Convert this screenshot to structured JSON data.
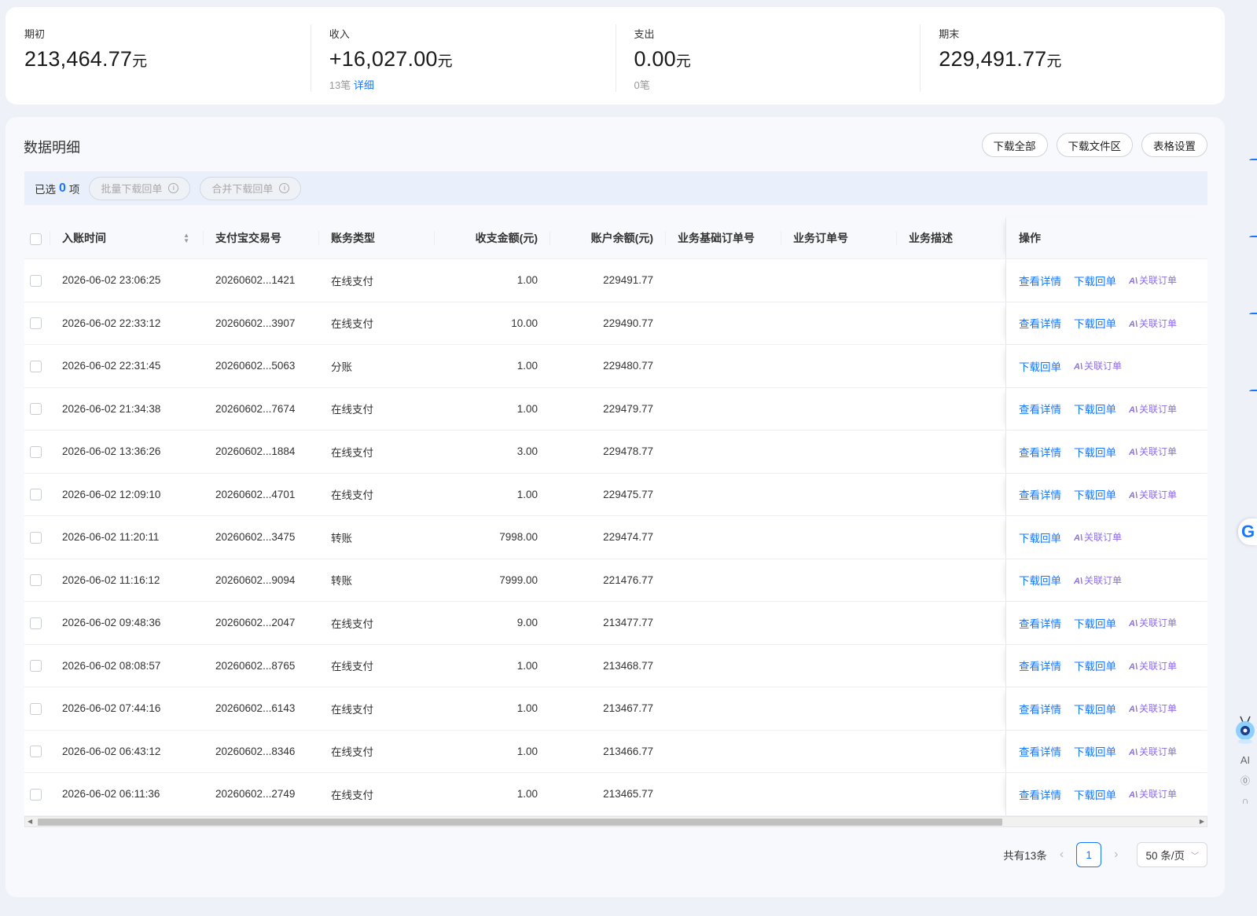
{
  "summary": {
    "items": [
      {
        "label": "期初",
        "value": "213,464.77",
        "unit": "元",
        "sub_count": "",
        "sub_link": ""
      },
      {
        "label": "收入",
        "value": "+16,027.00",
        "unit": "元",
        "sub_count": "13笔",
        "sub_link": "详细"
      },
      {
        "label": "支出",
        "value": "0.00",
        "unit": "元",
        "sub_count": "0笔",
        "sub_link": ""
      },
      {
        "label": "期末",
        "value": "229,491.77",
        "unit": "元",
        "sub_count": "",
        "sub_link": ""
      }
    ]
  },
  "panel": {
    "title": "数据明细",
    "buttons": [
      "下载全部",
      "下载文件区",
      "表格设置"
    ]
  },
  "selection": {
    "prefix": "已选",
    "count": "0",
    "suffix": "项",
    "batch_download": "批量下载回单",
    "merge_download": "合并下载回单"
  },
  "table": {
    "columns": [
      "入账时间",
      "支付宝交易号",
      "账务类型",
      "收支金额(元)",
      "账户余额(元)",
      "业务基础订单号",
      "业务订单号",
      "业务描述",
      "操作"
    ],
    "rows": [
      {
        "time": "2026-06-02 23:06:25",
        "tx": "20260602...1421",
        "type": "在线支付",
        "amount": "1.00",
        "balance": "229491.77",
        "ops": [
          "查看详情",
          "下载回单"
        ],
        "rel": "关联订单"
      },
      {
        "time": "2026-06-02 22:33:12",
        "tx": "20260602...3907",
        "type": "在线支付",
        "amount": "10.00",
        "balance": "229490.77",
        "ops": [
          "查看详情",
          "下载回单"
        ],
        "rel": "关联订单"
      },
      {
        "time": "2026-06-02 22:31:45",
        "tx": "20260602...5063",
        "type": "分账",
        "amount": "1.00",
        "balance": "229480.77",
        "ops": [
          "下载回单"
        ],
        "rel": "关联订单"
      },
      {
        "time": "2026-06-02 21:34:38",
        "tx": "20260602...7674",
        "type": "在线支付",
        "amount": "1.00",
        "balance": "229479.77",
        "ops": [
          "查看详情",
          "下载回单"
        ],
        "rel": "关联订单"
      },
      {
        "time": "2026-06-02 13:36:26",
        "tx": "20260602...1884",
        "type": "在线支付",
        "amount": "3.00",
        "balance": "229478.77",
        "ops": [
          "查看详情",
          "下载回单"
        ],
        "rel": "关联订单"
      },
      {
        "time": "2026-06-02 12:09:10",
        "tx": "20260602...4701",
        "type": "在线支付",
        "amount": "1.00",
        "balance": "229475.77",
        "ops": [
          "查看详情",
          "下载回单"
        ],
        "rel": "关联订单"
      },
      {
        "time": "2026-06-02 11:20:11",
        "tx": "20260602...3475",
        "type": "转账",
        "amount": "7998.00",
        "balance": "229474.77",
        "ops": [
          "下载回单"
        ],
        "rel": "关联订单"
      },
      {
        "time": "2026-06-02 11:16:12",
        "tx": "20260602...9094",
        "type": "转账",
        "amount": "7999.00",
        "balance": "221476.77",
        "ops": [
          "下载回单"
        ],
        "rel": "关联订单"
      },
      {
        "time": "2026-06-02 09:48:36",
        "tx": "20260602...2047",
        "type": "在线支付",
        "amount": "9.00",
        "balance": "213477.77",
        "ops": [
          "查看详情",
          "下载回单"
        ],
        "rel": "关联订单"
      },
      {
        "time": "2026-06-02 08:08:57",
        "tx": "20260602...8765",
        "type": "在线支付",
        "amount": "1.00",
        "balance": "213468.77",
        "ops": [
          "查看详情",
          "下载回单"
        ],
        "rel": "关联订单"
      },
      {
        "time": "2026-06-02 07:44:16",
        "tx": "20260602...6143",
        "type": "在线支付",
        "amount": "1.00",
        "balance": "213467.77",
        "ops": [
          "查看详情",
          "下载回单"
        ],
        "rel": "关联订单"
      },
      {
        "time": "2026-06-02 06:43:12",
        "tx": "20260602...8346",
        "type": "在线支付",
        "amount": "1.00",
        "balance": "213466.77",
        "ops": [
          "查看详情",
          "下载回单"
        ],
        "rel": "关联订单"
      },
      {
        "time": "2026-06-02 06:11:36",
        "tx": "20260602...2749",
        "type": "在线支付",
        "amount": "1.00",
        "balance": "213465.77",
        "ops": [
          "查看详情",
          "下载回单"
        ],
        "rel": "关联订单"
      }
    ]
  },
  "pagination": {
    "total": "共有13条",
    "current": "1",
    "page_size": "50 条/页"
  },
  "side": {
    "ai_label": "AI"
  },
  "colors": {
    "accent": "#1677ff",
    "link_purple": "#8c6ce8",
    "selection_bg": "#e9f0fc"
  }
}
